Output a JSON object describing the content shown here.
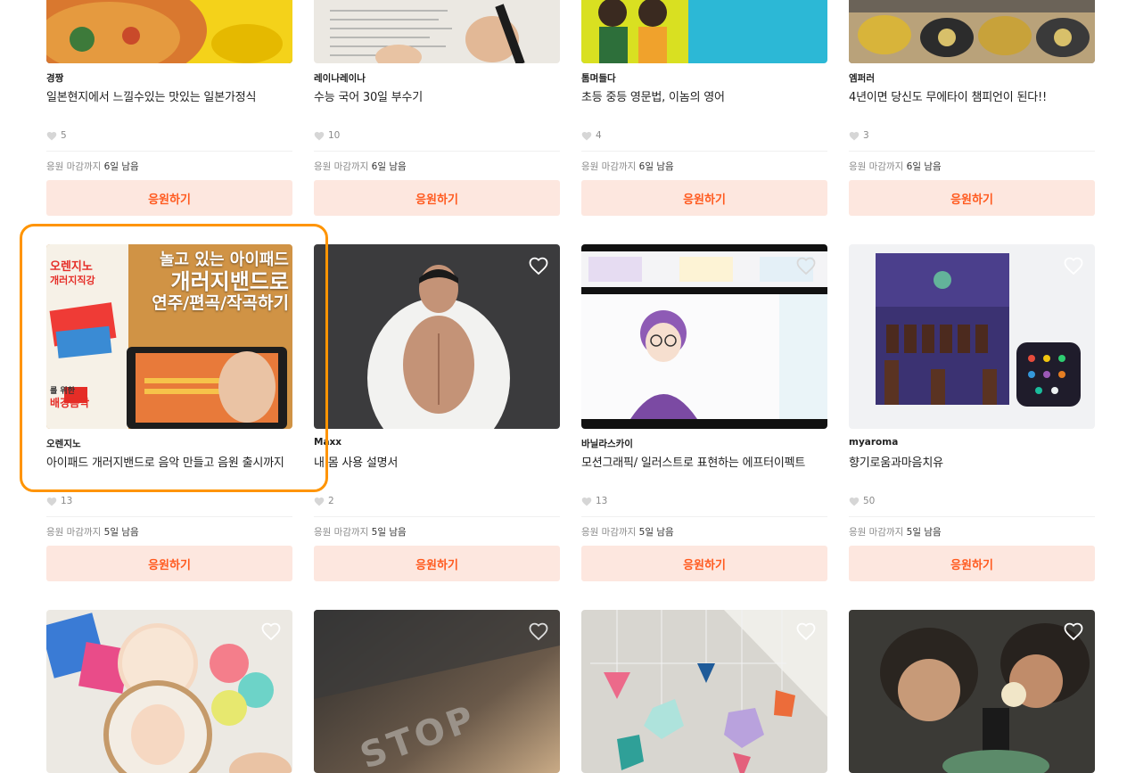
{
  "cta_label": "응원하기",
  "deadline_prefix": "응원 마감까지 ",
  "rows": [
    {
      "deadline_value": "6일 남음",
      "cards": [
        {
          "creator": "경짱",
          "title": "일본현지에서 느낄수있는 맛있는 일본가정식",
          "likes": "5",
          "image": "japanese-home-cooking-photo"
        },
        {
          "creator": "레이나레이나",
          "title": "수능 국어 30일 부수기",
          "likes": "10",
          "image": "korean-exam-study-photo"
        },
        {
          "creator": "톰며들다",
          "title": "초등 중등 영문법, 이놈의 영어",
          "likes": "4",
          "image": "english-grammar-kids-photo"
        },
        {
          "creator": "엠퍼러",
          "title": "4년이면 당신도 무에타이 챔피언이 된다!!",
          "likes": "3",
          "image": "muay-thai-belts-photo"
        }
      ]
    },
    {
      "deadline_value": "5일 남음",
      "cards": [
        {
          "creator": "오렌지노",
          "title": "아이패드 개러지밴드로 음악 만들고 음원 출시까지",
          "likes": "13",
          "image": "ipad-garageband-photo",
          "image_text": [
            "놀고 있는 아이패드",
            "개러지밴드로",
            "연주/편곡/작곡하기",
            "오렌지노",
            "개러지직강",
            "를 위한",
            "배경음악"
          ]
        },
        {
          "creator": "Maxx",
          "title": "내 몸 사용 설명서",
          "likes": "2",
          "image": "fitness-trainer-photo"
        },
        {
          "creator": "바닐라스카이",
          "title": "모션그래픽/ 일러스트로 표현하는 에프터이펙트",
          "likes": "13",
          "image": "motion-graphics-illustration"
        },
        {
          "creator": "myaroma",
          "title": "향기로움과마음치유",
          "likes": "50",
          "image": "aroma-oil-kit-photo"
        }
      ]
    },
    {
      "cards": [
        {
          "image": "punch-needle-craft-photo"
        },
        {
          "image": "stop-street-photo",
          "image_text": [
            "STOP"
          ]
        },
        {
          "image": "geometric-mobile-photo"
        },
        {
          "image": "kids-microscope-photo"
        }
      ]
    }
  ],
  "colors": {
    "accent": "#ff5a1f",
    "cta_bg": "#fde7df",
    "highlight": "#ff9400"
  }
}
